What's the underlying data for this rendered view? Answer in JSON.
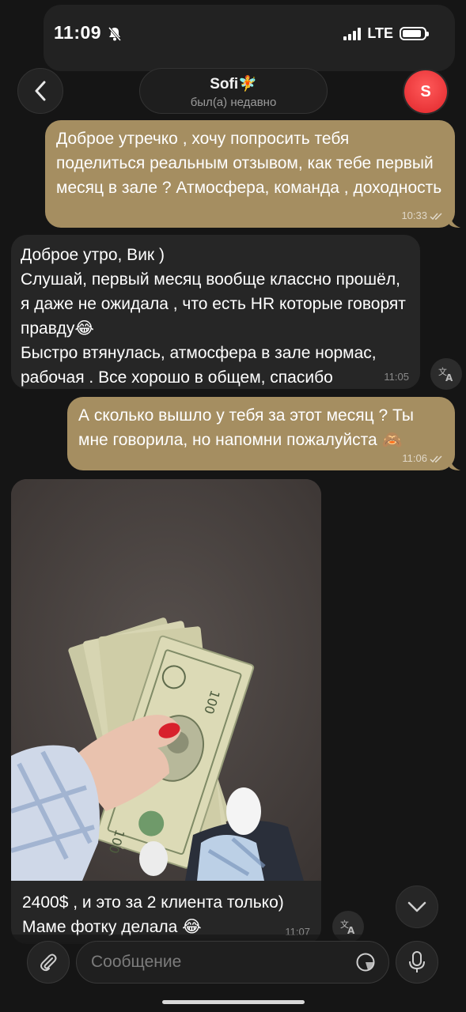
{
  "status_bar": {
    "time": "11:09",
    "network": "LTE",
    "battery_level": 0.9
  },
  "header": {
    "contact_name": "Sofi🧚",
    "contact_status": "был(а) недавно",
    "avatar_letter": "S",
    "avatar_color": "#e0262b"
  },
  "messages": [
    {
      "direction": "outgoing",
      "text": "Доброе утречко , хочу попросить тебя поделиться реальным отзывом, как тебе первый месяц в зале ? Атмосфера, команда , доходность",
      "time": "10:33",
      "read": true
    },
    {
      "direction": "incoming",
      "text": "Доброе утро, Вик )\nСлушай, первый месяц вообще классно прошёл, я даже не ожидала , что есть HR которые говорят правду😂\nБыстро втянулась, атмосфера в зале нормас, рабочая . Все хорошо в общем, спасибо",
      "time": "11:05"
    },
    {
      "direction": "outgoing",
      "text": "А сколько вышло у тебя за этот месяц ? Ты мне говорила, но напомни пожалуйста 🙈",
      "time": "11:06",
      "read": true
    },
    {
      "direction": "incoming",
      "type": "photo",
      "caption": "2400$ , и это за 2 клиента только)\nМаме фотку делала 😂",
      "time": "11:07"
    }
  ],
  "composer": {
    "placeholder": "Сообщение"
  },
  "colors": {
    "outgoing_bubble": "#a58e61",
    "incoming_bubble": "#262626",
    "background": "#151515"
  }
}
